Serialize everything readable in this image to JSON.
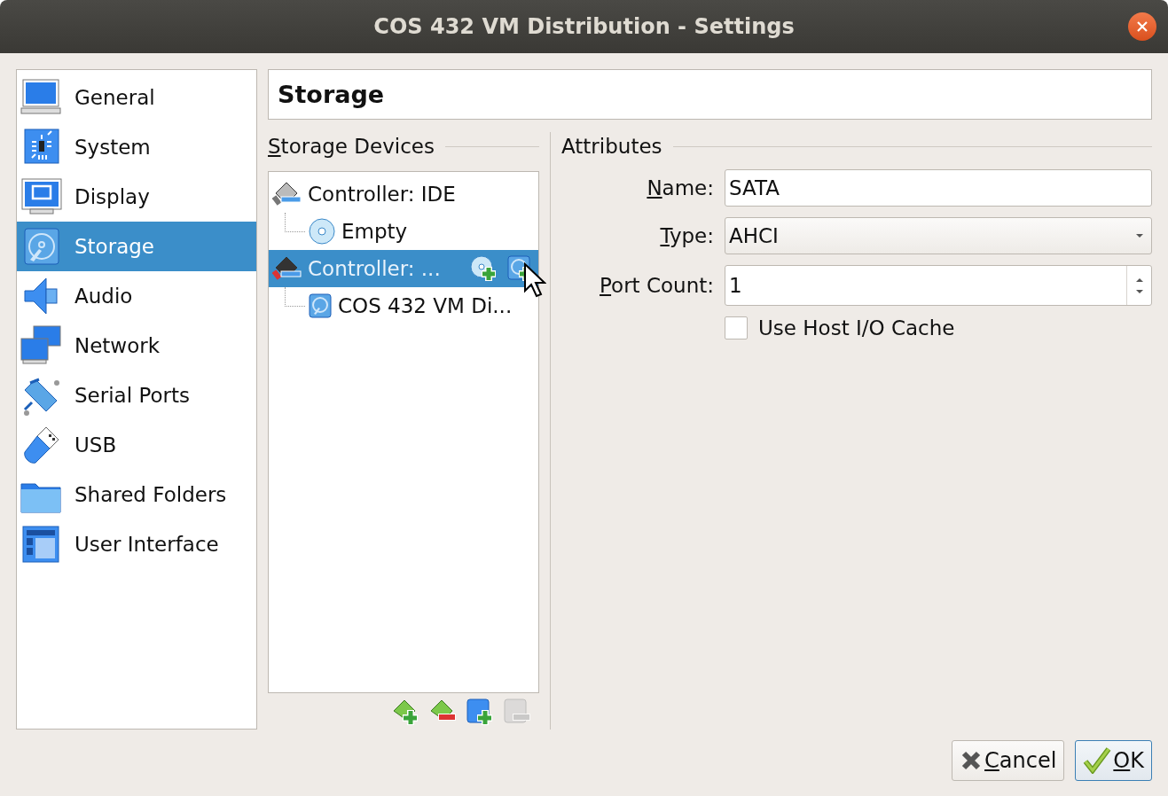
{
  "window": {
    "title": "COS 432 VM Distribution - Settings"
  },
  "sidebar": {
    "items": [
      {
        "label": "General",
        "kind": "general",
        "selected": false
      },
      {
        "label": "System",
        "kind": "system",
        "selected": false
      },
      {
        "label": "Display",
        "kind": "display",
        "selected": false
      },
      {
        "label": "Storage",
        "kind": "storage",
        "selected": true
      },
      {
        "label": "Audio",
        "kind": "audio",
        "selected": false
      },
      {
        "label": "Network",
        "kind": "network",
        "selected": false
      },
      {
        "label": "Serial Ports",
        "kind": "serial",
        "selected": false
      },
      {
        "label": "USB",
        "kind": "usb",
        "selected": false
      },
      {
        "label": "Shared Folders",
        "kind": "folder",
        "selected": false
      },
      {
        "label": "User Interface",
        "kind": "ui",
        "selected": false
      }
    ]
  },
  "page_title": "Storage",
  "storage_devices": {
    "heading": "Storage Devices",
    "heading_mnemonic": true,
    "tree": [
      {
        "label": "Controller: IDE",
        "kind": "controller",
        "selected": false,
        "children": [
          {
            "label": "Empty",
            "kind": "optical",
            "selected": false
          }
        ]
      },
      {
        "label": "Controller: ...",
        "kind": "controller",
        "selected": true,
        "children": [
          {
            "label": "COS 432 VM Di...",
            "kind": "harddisk",
            "selected": false
          }
        ]
      }
    ],
    "toolbar": [
      {
        "kind": "add-controller",
        "disabled": false
      },
      {
        "kind": "remove-controller",
        "disabled": false
      },
      {
        "kind": "add-attachment",
        "disabled": false
      },
      {
        "kind": "remove-attachment",
        "disabled": true
      }
    ]
  },
  "attributes": {
    "heading": "Attributes",
    "name": {
      "label": "Name:",
      "mnemonic": true,
      "value": "SATA"
    },
    "type": {
      "label": "Type:",
      "mnemonic": true,
      "value": "AHCI"
    },
    "port_count": {
      "label": "Port Count:",
      "mnemonic": true,
      "value": "1"
    },
    "host_io_cache": {
      "label": "Use Host I/O Cache",
      "checked": false
    }
  },
  "buttons": [
    {
      "label": "Cancel",
      "kind": "cancel",
      "mnemonic": true
    },
    {
      "label": "OK",
      "kind": "ok",
      "mnemonic": true
    }
  ]
}
